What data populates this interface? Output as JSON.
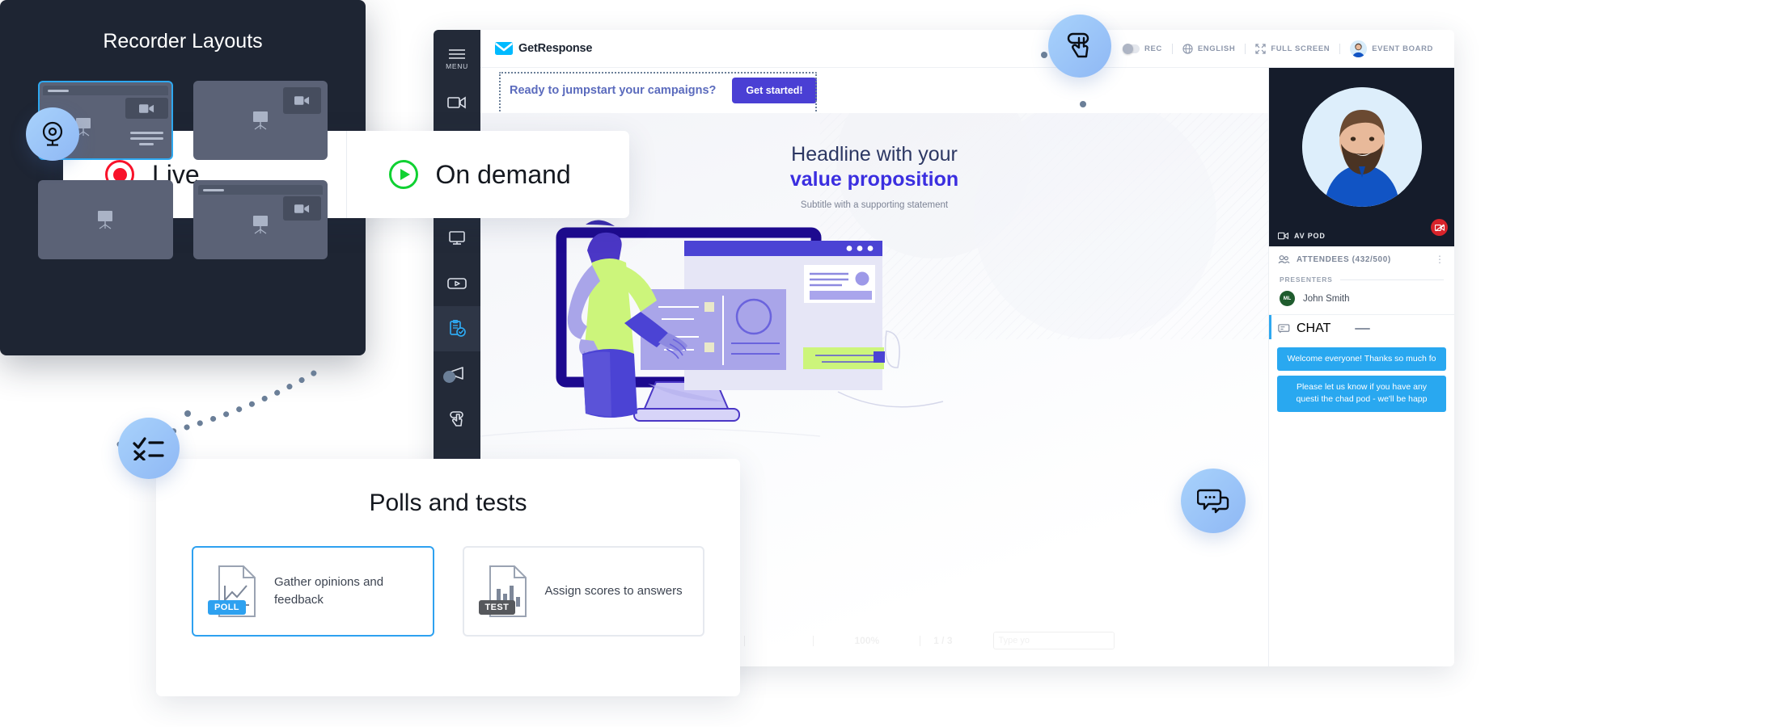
{
  "app": {
    "brand": "GetResponse",
    "menu_label": "MENU",
    "rail_items": [
      {
        "name": "menu",
        "label": "MENU",
        "icon": "hamburger-icon"
      },
      {
        "name": "camera",
        "label": "",
        "icon": "video-camera-icon"
      },
      {
        "name": "slides",
        "label": "",
        "icon": "slides-icon"
      },
      {
        "name": "whiteboard",
        "label": "",
        "icon": "whiteboard-icon"
      },
      {
        "name": "screen-share",
        "label": "",
        "icon": "monitor-share-icon"
      },
      {
        "name": "video-player",
        "label": "",
        "icon": "play-box-icon"
      },
      {
        "name": "polls",
        "label": "",
        "icon": "clipboard-check-icon"
      },
      {
        "name": "announcement",
        "label": "",
        "icon": "megaphone-icon"
      },
      {
        "name": "cta",
        "label": "",
        "icon": "hand-tap-icon"
      },
      {
        "name": "broadcast",
        "label": "",
        "icon": "broadcast-icon"
      }
    ],
    "topbar": {
      "rec_label": "REC",
      "language_label": "ENGLISH",
      "fullscreen_label": "FULL SCREEN",
      "event_board_label": "EVENT BOARD"
    },
    "notification": {
      "text": "Ready to jumpstart your campaigns?",
      "button": "Get started!"
    },
    "canvas": {
      "headline_line1": "Headline with your",
      "headline_line2": "value proposition",
      "subtitle": "Subtitle with a supporting statement"
    },
    "bottom_toolbar": {
      "zoom_level": "100%",
      "page_indicator": "1 / 3",
      "input_placeholder": "Type yo",
      "icons": [
        "undo-icon",
        "pointer-icon",
        "color-swatch-icon",
        "record-dot-icon",
        "eye-icon",
        "export-icon",
        "plus-icon",
        "minus-icon",
        "next-arrow-icon"
      ]
    },
    "right_panel": {
      "av_pod_label": "AV POD",
      "attendees_label": "ATTENDEES (432/500)",
      "presenters_label": "PRESENTERS",
      "presenter": {
        "initials": "ML",
        "name": "John Smith"
      },
      "chat_label": "CHAT",
      "messages": [
        "Welcome everyone! Thanks so much fo",
        "Please let us know if you have any questi the chad pod - we'll be happ"
      ]
    }
  },
  "live_card": {
    "live_label": "Live",
    "on_demand_label": "On demand"
  },
  "polls_card": {
    "title": "Polls and tests",
    "options": [
      {
        "tag": "POLL",
        "text": "Gather opinions and feedback",
        "selected": true
      },
      {
        "tag": "TEST",
        "text": "Assign scores to answers",
        "selected": false
      }
    ]
  },
  "recorder_card": {
    "title": "Recorder Layouts",
    "layouts": [
      {
        "name": "screen-with-sidebar",
        "selected": true
      },
      {
        "name": "screen-with-pip-camera",
        "selected": false
      },
      {
        "name": "screen-only",
        "selected": false
      },
      {
        "name": "titled-screen-with-pip-camera",
        "selected": false
      }
    ]
  },
  "badges": [
    {
      "name": "webcam-badge",
      "icon": "webcam-icon"
    },
    {
      "name": "quiz-badge",
      "icon": "checklist-icon"
    },
    {
      "name": "tap-badge",
      "icon": "hand-tap-icon"
    },
    {
      "name": "chat-badge",
      "icon": "chat-bubbles-icon"
    }
  ],
  "colors": {
    "accent_blue": "#2ea8f0",
    "brand_purple": "#4a3fd4",
    "notify_text": "#5b6bbd",
    "dark_panel": "#1e2533",
    "rail_dark": "#232a38",
    "live_red": "#f8122a",
    "ondemand_green": "#10d132"
  }
}
